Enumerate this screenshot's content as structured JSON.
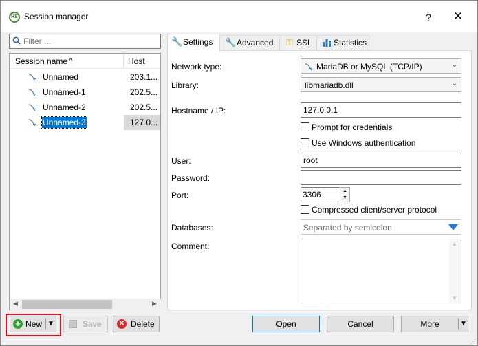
{
  "window": {
    "title": "Session manager",
    "help_label": "?",
    "close_label": "✕"
  },
  "filter": {
    "placeholder": "Filter ..."
  },
  "tree": {
    "columns": {
      "name": "Session name",
      "host": "Host"
    },
    "rows": [
      {
        "name": "Unnamed",
        "host": "203.1...",
        "selected": false
      },
      {
        "name": "Unnamed-1",
        "host": "202.5...",
        "selected": false
      },
      {
        "name": "Unnamed-2",
        "host": "202.5...",
        "selected": false
      },
      {
        "name": "Unnamed-3",
        "host": "127.0...",
        "selected": true
      }
    ]
  },
  "buttons": {
    "new": "New",
    "save": "Save",
    "delete": "Delete",
    "open": "Open",
    "cancel": "Cancel",
    "more": "More"
  },
  "tabs": [
    {
      "label": "Settings",
      "icon": "wrench-icon",
      "active": true
    },
    {
      "label": "Advanced",
      "icon": "wrench-orange-icon",
      "active": false
    },
    {
      "label": "SSL",
      "icon": "key-icon",
      "active": false
    },
    {
      "label": "Statistics",
      "icon": "bar-chart-icon",
      "active": false
    }
  ],
  "settings": {
    "network_type": {
      "label": "Network type:",
      "value": "MariaDB or MySQL (TCP/IP)"
    },
    "library": {
      "label": "Library:",
      "value": "libmariadb.dll"
    },
    "hostname": {
      "label": "Hostname / IP:",
      "value": "127.0.0.1"
    },
    "prompt_credentials": {
      "label": "Prompt for credentials",
      "checked": false
    },
    "windows_auth": {
      "label": "Use Windows authentication",
      "checked": false
    },
    "user": {
      "label": "User:",
      "value": "root"
    },
    "password": {
      "label": "Password:",
      "value": ""
    },
    "port": {
      "label": "Port:",
      "value": "3306"
    },
    "compressed": {
      "label": "Compressed client/server protocol",
      "checked": false
    },
    "databases": {
      "label": "Databases:",
      "placeholder": "Separated by semicolon"
    },
    "comment": {
      "label": "Comment:",
      "value": ""
    }
  },
  "colors": {
    "selection": "#0078d7",
    "highlight_border": "#e0101a",
    "accent": "#1e7ad6"
  }
}
